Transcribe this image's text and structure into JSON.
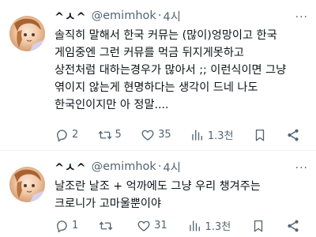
{
  "tweets": [
    {
      "display_name": "^ㅅ^",
      "handle": "@emimhok",
      "separator": "·",
      "time": "4시",
      "more": "···",
      "text": "솔직히 말해서 한국 커뮤는 (많이)엉망이고 한국\n게임중엔 그런 커뮤를 먹금 뒤지게못하고\n상전처럼 대하는경우가 많아서 ;; 이런식이면 그냥\n엮이지 않는게 현명하다는 생각이 드네 나도\n한국인이지만 아 정말....",
      "replies": "2",
      "retweets": "5",
      "likes": "35",
      "views": "1.3천",
      "icons": [
        "reply-icon",
        "retweet-icon",
        "like-icon",
        "views-icon",
        "bookmark-icon",
        "share-icon"
      ]
    },
    {
      "display_name": "^ㅅ^",
      "handle": "@emimhok",
      "separator": "·",
      "time": "4시",
      "more": "···",
      "text": "날조란 날조 + 억까에도 그냥 우리 챙겨주는\n크로니가 고마울뿐이야",
      "replies": "1",
      "retweets": "",
      "likes": "31",
      "views": "1.3천",
      "icons": [
        "reply-icon",
        "retweet-icon",
        "like-icon",
        "views-icon",
        "bookmark-icon",
        "share-icon"
      ]
    }
  ]
}
